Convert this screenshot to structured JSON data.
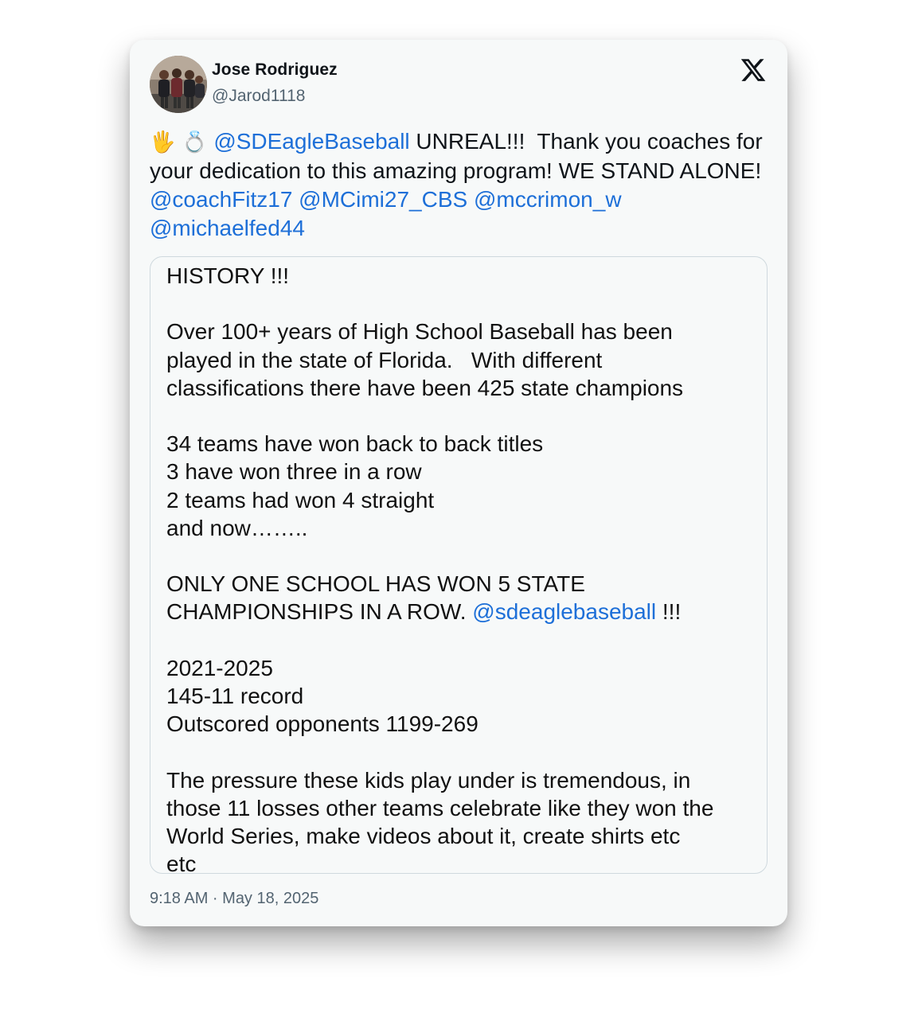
{
  "author": {
    "name": "Jose Rodriguez",
    "handle": "@Jarod1118"
  },
  "icons": {
    "platform": "x-logo-icon",
    "emoji_1": "raised-hand-emoji",
    "emoji_2": "ring-emoji"
  },
  "tweet": {
    "emoji_1": "🖐",
    "emoji_2": "💍",
    "mention_1": "@SDEagleBaseball",
    "text_1": " UNREAL!!!  Thank you coaches for your dedication to this amazing program! WE STAND ALONE!  ",
    "mention_2": "@coachFitz17",
    "mention_3": "@MCimi27_CBS",
    "mention_4": "@mccrimon_w",
    "mention_5": "@michaelfed44"
  },
  "image_text": {
    "l1": "HISTORY !!!",
    "l2": "",
    "l3": "Over 100+ years of High School Baseball has been",
    "l4": "played in the state of Florida.   With different",
    "l5": "classifications there have been 425 state champions",
    "l6": "",
    "l7": "34 teams have won back to back titles",
    "l8": "3 have won three in a row",
    "l9": "2 teams had won 4 straight",
    "l10": "and now……..",
    "l11": "",
    "l12": "ONLY ONE SCHOOL HAS WON 5 STATE",
    "l13a": "CHAMPIONSHIPS IN A ROW. ",
    "l13b": "@sdeaglebaseball",
    "l13c": " !!!",
    "l14": "",
    "l15": "2021-2025",
    "l16": "145-11 record",
    "l17": "Outscored opponents 1199-269",
    "l18": "",
    "l19": "The pressure these kids play under is tremendous, in",
    "l20": "those 11 losses other teams celebrate like they won the",
    "l21": "World Series, make videos about it, create shirts etc",
    "l22": "etc"
  },
  "timestamp": "9:18 AM · May 18, 2025",
  "colors": {
    "link": "#1d6fd8",
    "text": "#0f1419",
    "muted": "#536471",
    "card": "#f7f9f9"
  }
}
